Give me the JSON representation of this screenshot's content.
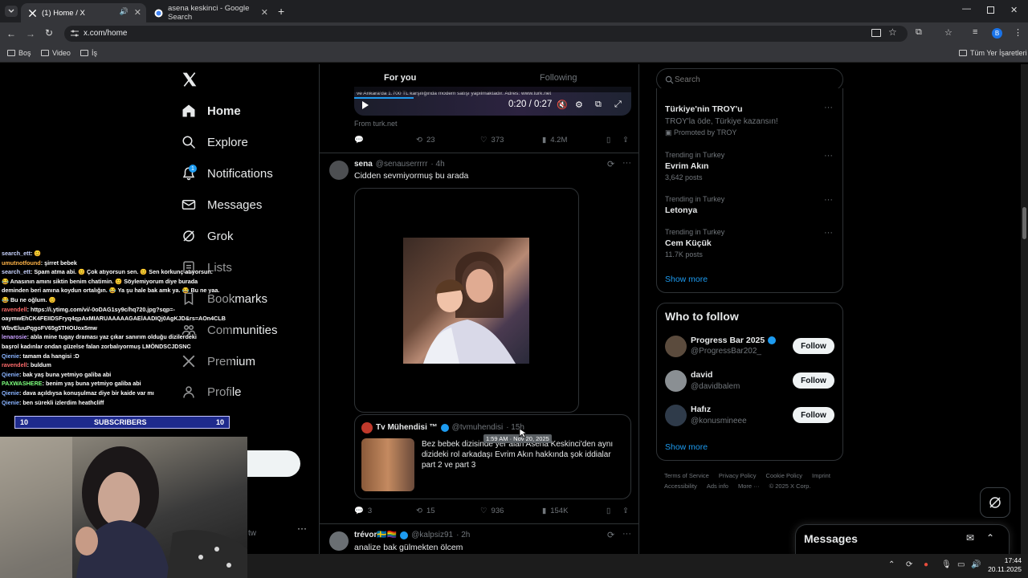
{
  "browser": {
    "tabs": [
      {
        "title": "(1) Home / X",
        "icon": "x-logo-icon",
        "active": true
      },
      {
        "title": "asena keskinci - Google Search",
        "icon": "google-icon",
        "active": false
      }
    ],
    "url": "x.com/home",
    "bookmarks": [
      {
        "label": "Boş",
        "icon": "folder-icon"
      },
      {
        "label": "Video",
        "icon": "folder-icon"
      },
      {
        "label": "İş",
        "icon": "folder-icon"
      }
    ],
    "all_bookmarks": "Tüm Yer İşaretleri"
  },
  "nav": {
    "items": [
      {
        "label": "Home",
        "icon": "home-icon"
      },
      {
        "label": "Explore",
        "icon": "search-icon"
      },
      {
        "label": "Notifications",
        "icon": "bell-icon",
        "badge": "1"
      },
      {
        "label": "Messages",
        "icon": "mail-icon"
      },
      {
        "label": "Grok",
        "icon": "grok-icon"
      },
      {
        "label": "Lists",
        "icon": "list-icon"
      },
      {
        "label": "Bookmarks",
        "icon": "bookmark-icon"
      },
      {
        "label": "Communities",
        "icon": "people-icon"
      },
      {
        "label": "Premium",
        "icon": "x-logo-icon"
      },
      {
        "label": "Profile",
        "icon": "person-icon"
      }
    ],
    "account_handle_fragment": "tw"
  },
  "feed": {
    "tabs": [
      {
        "label": "For you",
        "active": true
      },
      {
        "label": "Following",
        "active": false
      }
    ],
    "video": {
      "caption_overlay": "ve Ankara'da 1.700 TL karşılığında modem satışı yapılmaktadır. Adres: www.turk.net",
      "time": "0:20 / 0:27",
      "source": "From turk.net"
    },
    "post0_actions": {
      "retweets": "23",
      "likes": "373",
      "views": "4.2M"
    },
    "post1": {
      "name": "sena",
      "handle": "@senauserrrrr",
      "time": "· 4h",
      "text": "Cidden sevmiyormuş bu arada",
      "quote": {
        "name": "Tv Mühendisi ™",
        "handle": "@tvmuhendisi",
        "time": "· 15h",
        "tooltip": "1:59 AM · Nov 20, 2025",
        "text": "Bez bebek dizisinde yer alan Asena Keskinci'den aynı dizideki rol arkadaşı Evrim Akın hakkında şok iddialar part 2 ve part 3"
      },
      "actions": {
        "replies": "3",
        "retweets": "15",
        "likes": "936",
        "views": "154K"
      }
    },
    "post2": {
      "name": "trévor🇸🇪🏳️‍🌈",
      "handle": "@kalpsiz91",
      "time": "· 2h",
      "text": "analize bak gülmekten ölcem"
    }
  },
  "search": {
    "placeholder": "Search"
  },
  "trends": {
    "promoted": {
      "title": "Türkiye'nin TROY'u",
      "subtitle": "TROY'la öde, Türkiye kazansın!",
      "label": "Promoted by TROY"
    },
    "items": [
      {
        "context": "Trending in Turkey",
        "name": "Evrim Akın",
        "posts": "3,642 posts"
      },
      {
        "context": "Trending in Turkey",
        "name": "Letonya",
        "posts": ""
      },
      {
        "context": "Trending in Turkey",
        "name": "Cem Küçük",
        "posts": "11.7K posts"
      }
    ],
    "show_more": "Show more"
  },
  "who_to_follow": {
    "title": "Who to follow",
    "users": [
      {
        "name": "Progress Bar 2025",
        "handle": "@ProgressBar202_",
        "verified": true,
        "button": "Follow"
      },
      {
        "name": "david",
        "handle": "@davidbalem",
        "verified": false,
        "button": "Follow"
      },
      {
        "name": "Hafız",
        "handle": "@konusmineee",
        "verified": false,
        "button": "Follow"
      }
    ],
    "show_more": "Show more"
  },
  "footer": {
    "links": [
      "Terms of Service",
      "Privacy Policy",
      "Cookie Policy",
      "Imprint",
      "Accessibility",
      "Ads info",
      "More ···"
    ],
    "copyright": "© 2025 X Corp."
  },
  "messages_drawer": {
    "title": "Messages"
  },
  "stream_overlay": {
    "chat": [
      {
        "user": "search_ett",
        "color": "#c9d4ff",
        "text": ": 😊"
      },
      {
        "user": "umutnotfound",
        "color": "#ffb347",
        "text": ": şirret bebek"
      },
      {
        "user": "search_ett",
        "color": "#c9d4ff",
        "text": ": Spam atma abi. 😊 Çok atıyorsun sen. 😊 Sen korkunç atıyorsun."
      },
      {
        "user": "",
        "color": "#ffffff",
        "text": "😂 Anasının amını siktin benim chatimin. 😊 Söylemiyorum diye burada"
      },
      {
        "user": "",
        "color": "#ffffff",
        "text": "deminden beri amına koydun ortalığın. 😂 Ya şu hale bak amk ya. 😂 Bu ne yaa."
      },
      {
        "user": "",
        "color": "#ffffff",
        "text": "😂 Bu ne oğlum. 😊"
      },
      {
        "user": "ravendell",
        "color": "#ff6b6b",
        "text": ": https://i.ytimg.com/vi/-0oDAG1sy9c/hq720.jpg?sqp=-"
      },
      {
        "user": "",
        "color": "#ffffff",
        "text": "oaymwEhCK4FEIIDSFryq4qpAxMIARUAAAAAGAElAADIQj0AgKJD&rs=AOn4CLB"
      },
      {
        "user": "",
        "color": "#ffffff",
        "text": "WbvEluuPqgoFV65g5THOUox5mw"
      },
      {
        "user": "lenarosie",
        "color": "#c9a0ff",
        "text": ": abla mine tugay draması yaz çıkar sanırım olduğu dizilerdeki"
      },
      {
        "user": "",
        "color": "#ffffff",
        "text": "başrol kadınlar ondan güzelse falan zorbalıyormuş LMÖNDSCJDSNC"
      },
      {
        "user": "Qienie",
        "color": "#8ab4ff",
        "text": ": tamam da hangisi :D"
      },
      {
        "user": "ravendell",
        "color": "#ff6b6b",
        "text": ": buldum"
      },
      {
        "user": "Qienie",
        "color": "#8ab4ff",
        "text": ": bak yaş buna yetmiyo galiba abi"
      },
      {
        "user": "PAXWASHERE",
        "color": "#7dff7d",
        "text": ": benim yaş buna yetmiyo galiba abi"
      },
      {
        "user": "Qienie",
        "color": "#8ab4ff",
        "text": ": dava açıldıysa konuşulmaz diye bir kaide var mı"
      },
      {
        "user": "Qienie",
        "color": "#8ab4ff",
        "text": ": ben sürekli izlerdim heathcliff"
      }
    ],
    "subs_bar": {
      "left": "10",
      "label": "SUBSCRIBERS",
      "right": "10"
    }
  },
  "taskbar": {
    "time": "17:44",
    "date": "20.11.2025"
  },
  "colors": {
    "accent": "#1d9bf0",
    "background": "#000000",
    "border": "#2f3336",
    "muted": "#71767b",
    "subs_bar": "#1e2a8c"
  }
}
